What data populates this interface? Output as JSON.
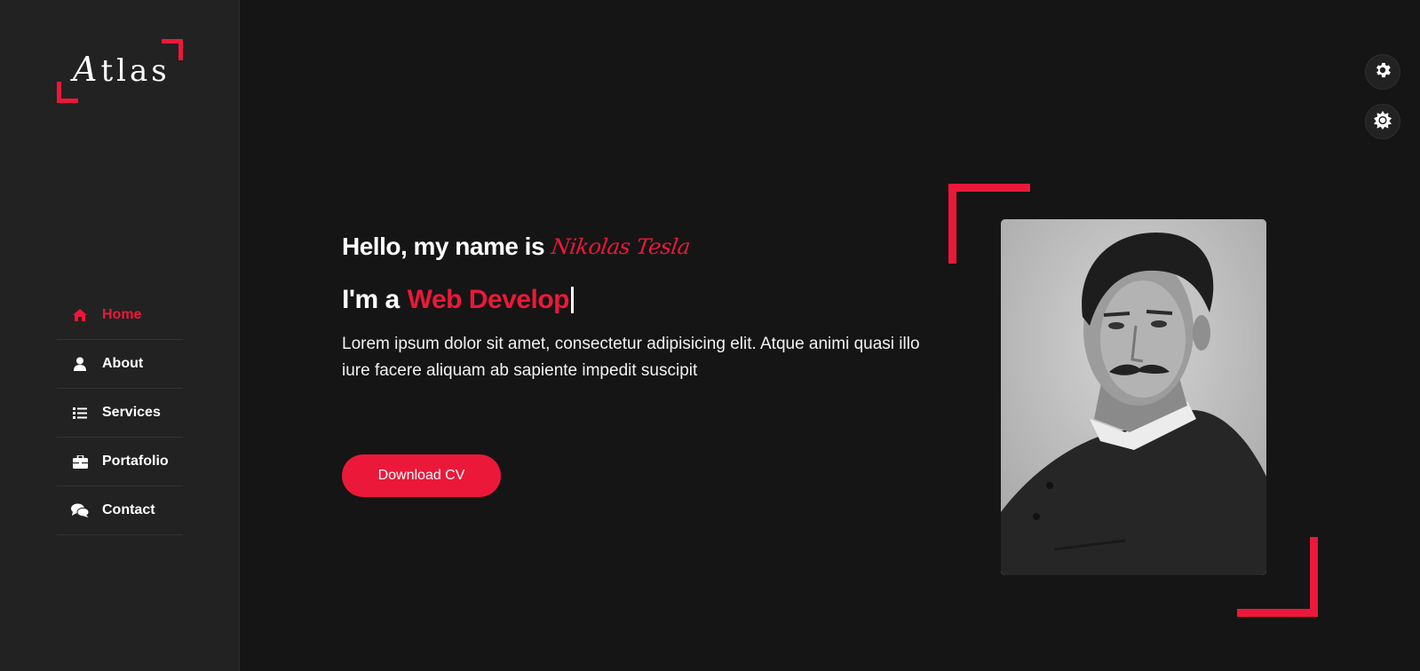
{
  "logo": {
    "first_letter": "A",
    "rest": "tlas"
  },
  "nav": {
    "items": [
      {
        "label": "Home",
        "icon": "home-icon",
        "active": true
      },
      {
        "label": "About",
        "icon": "user-icon",
        "active": false
      },
      {
        "label": "Services",
        "icon": "list-icon",
        "active": false
      },
      {
        "label": "Portafolio",
        "icon": "briefcase-icon",
        "active": false
      },
      {
        "label": "Contact",
        "icon": "comments-icon",
        "active": false
      }
    ]
  },
  "hero": {
    "greeting": "Hello, my name is",
    "name": "Nikolas Tesla",
    "role_prefix": "I'm a",
    "role_typed": "Web Develop",
    "description": "Lorem ipsum dolor sit amet, consectetur adipisicing elit. Atque animi quasi illo iure facere aliquam ab sapiente impedit suscipit",
    "cta_label": "Download CV"
  },
  "controls": {
    "settings_icon": "gear-icon",
    "theme_icon": "sun-icon"
  },
  "colors": {
    "accent": "#ec1839",
    "background": "#151515",
    "sidebar": "#222222",
    "text": "#ffffff"
  }
}
